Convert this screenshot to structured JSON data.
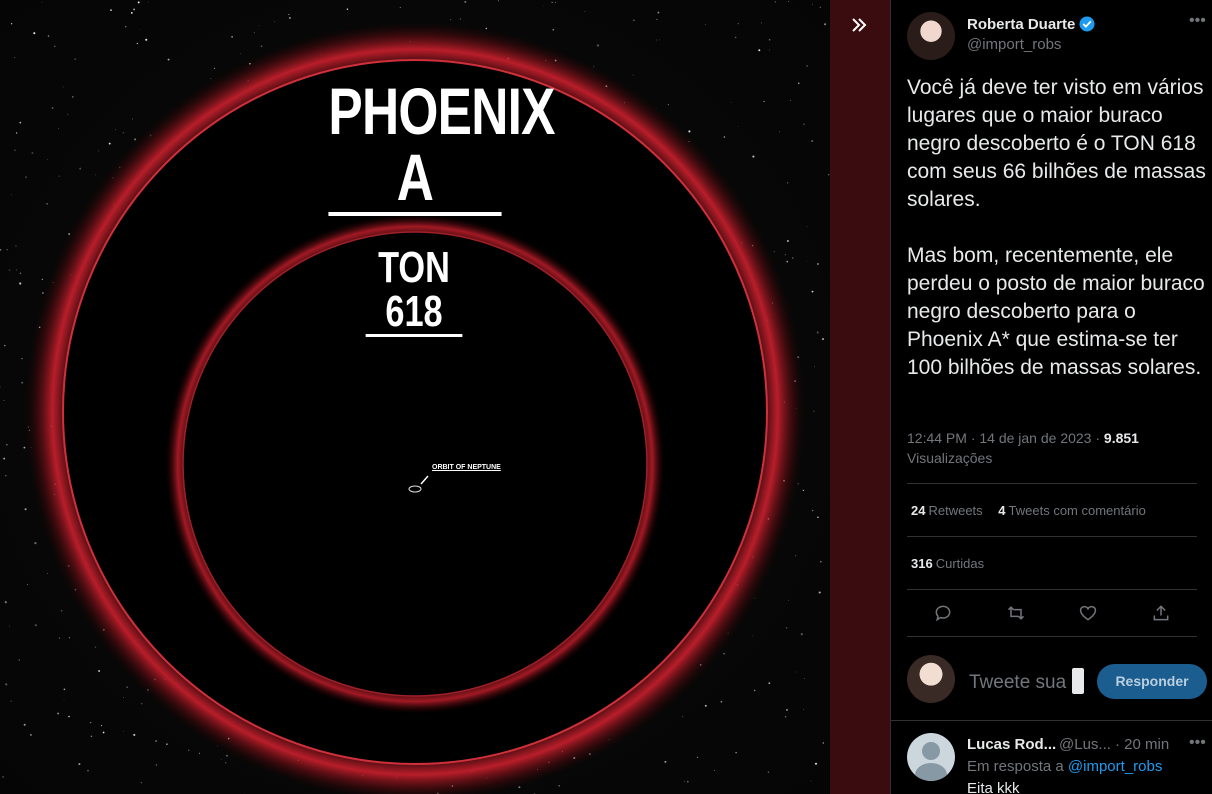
{
  "media": {
    "title_large": "PHOENIX A",
    "title_small": "TON 618",
    "neptune_label": "ORBIT OF NEPTUNE"
  },
  "viewer": {
    "collapse_icon": "double-chevron-right-icon"
  },
  "tweet": {
    "author_name": "Roberta Duarte",
    "author_handle": "@import_robs",
    "paragraph_1": "Você já deve ter visto em vários lugares que o maior buraco negro descoberto é o TON 618 com seus 66 bilhões de massas solares.",
    "paragraph_2": "Mas bom, recentemente, ele perdeu o posto de maior buraco negro descoberto para o Phoenix A* que estima-se ter 100 bilhões de massas solares.",
    "timestamp": "12:44 PM · 14 de jan de 2023 · ",
    "views_count": "9.851",
    "views_label": "Visualizações",
    "retweets_count": "24",
    "retweets_label": "Retweets",
    "quotes_count": "4",
    "quotes_label": "Tweets com comentário",
    "likes_count": "316",
    "likes_label": "Curtidas"
  },
  "reply_box": {
    "input_text": "Tweete sua",
    "button_label": "Responder"
  },
  "reply": {
    "name": "Lucas Rod...",
    "handle": "@Lus...",
    "time": "· 20 min",
    "reply_prefix": "Em resposta a",
    "reply_to": "@import_robs",
    "text": "Eita kkk"
  },
  "colors": {
    "accent": "#1d9bf0",
    "reply_button_bg": "#1b5d8f",
    "halo_red": "#c21f2c"
  }
}
